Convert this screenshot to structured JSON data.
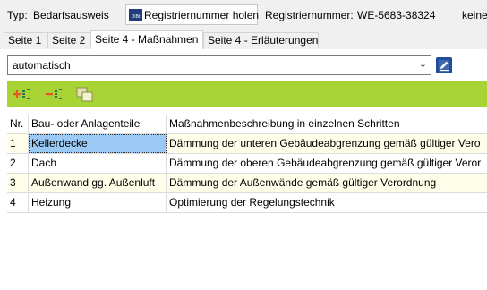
{
  "header": {
    "type_label": "Typ:",
    "type_value": "Bedarfsausweis",
    "register_button_label": "Registriernummer holen",
    "register_button_icon": "dibt-logo-icon",
    "register_number_label": "Registriernummer:",
    "register_number_value": "WE-5683-38324",
    "trailing_text": "keine"
  },
  "tabs": [
    {
      "label": "Seite 1",
      "active": false
    },
    {
      "label": "Seite 2",
      "active": false
    },
    {
      "label": "Seite 4 - Maßnahmen",
      "active": true
    },
    {
      "label": "Seite 4 - Erläuterungen",
      "active": false
    }
  ],
  "mode_select": {
    "value": "automatisch",
    "edit_icon": "pencil-icon"
  },
  "toolbar": {
    "color": "#a8d334",
    "icons": [
      "add-row-icon",
      "remove-row-icon",
      "copy-icon"
    ]
  },
  "table": {
    "columns": [
      "Nr.",
      "Bau- oder Anlagenteile",
      "Maßnahmenbeschreibung in einzelnen Schritten"
    ],
    "rows": [
      {
        "nr": "1",
        "part": "Kellerdecke",
        "description": "Dämmung der unteren Gebäudeabgrenzung gemäß gültiger Vero"
      },
      {
        "nr": "2",
        "part": "Dach",
        "description": "Dämmung der oberen Gebäudeabgrenzung gemäß gültiger Veror"
      },
      {
        "nr": "3",
        "part": "Außenwand gg. Außenluft",
        "description": "Dämmung der Außenwände gemäß gültiger Verordnung"
      },
      {
        "nr": "4",
        "part": "Heizung",
        "description": "Optimierung der Regelungstechnik"
      }
    ],
    "selected_row": 1,
    "alt_row_color": "#fffee8",
    "selection_color": "#99c9f4"
  }
}
